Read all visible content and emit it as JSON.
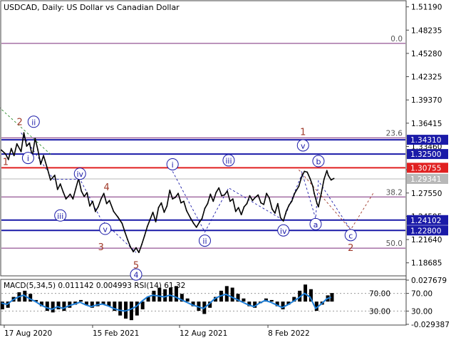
{
  "chart_data": {
    "type": "line",
    "title": "USDCAD, Daily:  US Dollar vs Canadian Dollar",
    "price_axis": {
      "ylim": [
        1.1703,
        1.5206
      ],
      "ticks": [
        "1.51190",
        "1.48235",
        "1.45280",
        "1.42325",
        "1.39370",
        "1.36415",
        "1.33460",
        "1.30505",
        "1.27550",
        "1.24595",
        "1.21640",
        "1.18685"
      ]
    },
    "x_axis": {
      "ticks": [
        {
          "label": "17 Aug 2020",
          "bar": 2
        },
        {
          "label": "15 Feb 2021",
          "bar": 65
        },
        {
          "label": "12 Aug 2021",
          "bar": 127
        },
        {
          "label": "8 Feb 2022",
          "bar": 190
        }
      ],
      "bars_total": 288
    },
    "levels": [
      {
        "price": 1.3431,
        "label": "1.34310",
        "color": "#1a1aa8",
        "kind": "support-resistance"
      },
      {
        "price": 1.325,
        "label": "1.32500",
        "color": "#1a1aa8",
        "kind": "support-resistance"
      },
      {
        "price": 1.30755,
        "label": "1.30755",
        "color": "#e02020",
        "kind": "pivot"
      },
      {
        "price": 1.2934,
        "label": "1.29341",
        "color": "#b8b8b8",
        "kind": "current-price"
      },
      {
        "price": 1.2411,
        "label": "1.24102",
        "color": "#1a1aa8",
        "kind": "support-resistance"
      },
      {
        "price": 1.228,
        "label": "1.22800",
        "color": "#1a1aa8",
        "kind": "support-resistance"
      }
    ],
    "fibonacci": [
      {
        "price": 1.4655,
        "label": "0.0"
      },
      {
        "price": 1.3455,
        "label": "23.6"
      },
      {
        "price": 1.2705,
        "label": "38.2"
      },
      {
        "price": 1.2055,
        "label": "50.0"
      }
    ],
    "price_series": [
      [
        0,
        1.33
      ],
      [
        3,
        1.325
      ],
      [
        5,
        1.318
      ],
      [
        7,
        1.332
      ],
      [
        9,
        1.323
      ],
      [
        11,
        1.338
      ],
      [
        14,
        1.328
      ],
      [
        16,
        1.352
      ],
      [
        18,
        1.335
      ],
      [
        20,
        1.339
      ],
      [
        22,
        1.322
      ],
      [
        24,
        1.345
      ],
      [
        26,
        1.33
      ],
      [
        28,
        1.312
      ],
      [
        30,
        1.323
      ],
      [
        33,
        1.305
      ],
      [
        35,
        1.292
      ],
      [
        38,
        1.298
      ],
      [
        40,
        1.28
      ],
      [
        42,
        1.287
      ],
      [
        44,
        1.277
      ],
      [
        46,
        1.268
      ],
      [
        49,
        1.274
      ],
      [
        51,
        1.268
      ],
      [
        53,
        1.281
      ],
      [
        55,
        1.294
      ],
      [
        57,
        1.278
      ],
      [
        59,
        1.271
      ],
      [
        61,
        1.276
      ],
      [
        63,
        1.259
      ],
      [
        65,
        1.265
      ],
      [
        67,
        1.252
      ],
      [
        69,
        1.258
      ],
      [
        71,
        1.268
      ],
      [
        73,
        1.275
      ],
      [
        75,
        1.262
      ],
      [
        77,
        1.266
      ],
      [
        80,
        1.252
      ],
      [
        83,
        1.245
      ],
      [
        86,
        1.237
      ],
      [
        88,
        1.226
      ],
      [
        90,
        1.216
      ],
      [
        92,
        1.207
      ],
      [
        94,
        1.201
      ],
      [
        96,
        1.206
      ],
      [
        98,
        1.2
      ],
      [
        100,
        1.21
      ],
      [
        102,
        1.221
      ],
      [
        104,
        1.233
      ],
      [
        106,
        1.242
      ],
      [
        108,
        1.251
      ],
      [
        110,
        1.239
      ],
      [
        112,
        1.257
      ],
      [
        114,
        1.263
      ],
      [
        116,
        1.251
      ],
      [
        118,
        1.259
      ],
      [
        120,
        1.279
      ],
      [
        122,
        1.268
      ],
      [
        124,
        1.27
      ],
      [
        126,
        1.275
      ],
      [
        128,
        1.263
      ],
      [
        130,
        1.265
      ],
      [
        132,
        1.253
      ],
      [
        135,
        1.243
      ],
      [
        137,
        1.237
      ],
      [
        139,
        1.232
      ],
      [
        141,
        1.238
      ],
      [
        143,
        1.243
      ],
      [
        145,
        1.256
      ],
      [
        147,
        1.262
      ],
      [
        149,
        1.274
      ],
      [
        151,
        1.265
      ],
      [
        153,
        1.276
      ],
      [
        155,
        1.282
      ],
      [
        157,
        1.272
      ],
      [
        159,
        1.273
      ],
      [
        161,
        1.278
      ],
      [
        163,
        1.265
      ],
      [
        165,
        1.268
      ],
      [
        167,
        1.252
      ],
      [
        169,
        1.257
      ],
      [
        171,
        1.248
      ],
      [
        173,
        1.258
      ],
      [
        175,
        1.262
      ],
      [
        177,
        1.272
      ],
      [
        179,
        1.266
      ],
      [
        181,
        1.27
      ],
      [
        183,
        1.273
      ],
      [
        185,
        1.263
      ],
      [
        187,
        1.261
      ],
      [
        189,
        1.275
      ],
      [
        191,
        1.269
      ],
      [
        193,
        1.255
      ],
      [
        195,
        1.25
      ],
      [
        197,
        1.262
      ],
      [
        199,
        1.244
      ],
      [
        201,
        1.24
      ],
      [
        203,
        1.252
      ],
      [
        205,
        1.26
      ],
      [
        207,
        1.265
      ],
      [
        209,
        1.275
      ],
      [
        212,
        1.284
      ],
      [
        214,
        1.296
      ],
      [
        216,
        1.303
      ],
      [
        218,
        1.302
      ],
      [
        220,
        1.294
      ],
      [
        222,
        1.284
      ],
      [
        223,
        1.275
      ],
      [
        225,
        1.262
      ],
      [
        226,
        1.258
      ],
      [
        228,
        1.275
      ],
      [
        230,
        1.293
      ],
      [
        232,
        1.304
      ],
      [
        233,
        1.298
      ],
      [
        235,
        1.292
      ],
      [
        237,
        1.294
      ]
    ],
    "wave_labels": [
      {
        "text": "1",
        "bar": 3,
        "price": 1.315,
        "color": "#a03a2a",
        "circle": false
      },
      {
        "text": "2",
        "bar": 13,
        "price": 1.366,
        "color": "#a03a2a",
        "circle": false
      },
      {
        "text": "ii",
        "bar": 23,
        "price": 1.366,
        "color": "#1a1aa8",
        "circle": true
      },
      {
        "text": "i",
        "bar": 19,
        "price": 1.32,
        "color": "#1a1aa8",
        "circle": true
      },
      {
        "text": "iv",
        "bar": 56,
        "price": 1.3,
        "color": "#1a1aa8",
        "circle": true
      },
      {
        "text": "4",
        "bar": 75,
        "price": 1.283,
        "color": "#a03a2a",
        "circle": false
      },
      {
        "text": "iii",
        "bar": 42,
        "price": 1.247,
        "color": "#1a1aa8",
        "circle": true
      },
      {
        "text": "v",
        "bar": 74,
        "price": 1.23,
        "color": "#1a1aa8",
        "circle": true
      },
      {
        "text": "3",
        "bar": 71,
        "price": 1.207,
        "color": "#a03a2a",
        "circle": false
      },
      {
        "text": "5",
        "bar": 96,
        "price": 1.184,
        "color": "#a03a2a",
        "circle": false
      },
      {
        "text": "(",
        "bar": 94,
        "price": 1.174,
        "color": "#2a8a2a",
        "circle": false
      },
      {
        "text": "(",
        "bar": 95,
        "price": 1.172,
        "color": "#2a8a2a",
        "circle": false
      },
      {
        "text": "4",
        "bar": 96,
        "price": 1.172,
        "color": "#1a1aa8",
        "circle": true
      },
      {
        "text": "i",
        "bar": 122,
        "price": 1.312,
        "color": "#1a1aa8",
        "circle": true
      },
      {
        "text": "ii",
        "bar": 145,
        "price": 1.215,
        "color": "#1a1aa8",
        "circle": true
      },
      {
        "text": "iii",
        "bar": 162,
        "price": 1.317,
        "color": "#1a1aa8",
        "circle": true
      },
      {
        "text": "iv",
        "bar": 201,
        "price": 1.228,
        "color": "#1a1aa8",
        "circle": true
      },
      {
        "text": "v",
        "bar": 215,
        "price": 1.336,
        "color": "#1a1aa8",
        "circle": true
      },
      {
        "text": "1",
        "bar": 215,
        "price": 1.353,
        "color": "#a03a2a",
        "circle": false
      },
      {
        "text": "b",
        "bar": 226,
        "price": 1.316,
        "color": "#1a1aa8",
        "circle": true
      },
      {
        "text": "a",
        "bar": 224,
        "price": 1.236,
        "color": "#1a1aa8",
        "circle": true
      },
      {
        "text": "c",
        "bar": 249,
        "price": 1.222,
        "color": "#1a1aa8",
        "circle": true
      },
      {
        "text": "2",
        "bar": 249,
        "price": 1.206,
        "color": "#a03a2a",
        "circle": false
      }
    ],
    "trend_lines": [
      {
        "color": "#2a8a2a",
        "dash": true,
        "points": [
          [
            -2,
            1.385
          ],
          [
            36,
            1.323
          ]
        ]
      },
      {
        "color": "#1a1aa8",
        "dash": true,
        "points": [
          [
            14,
            1.352
          ],
          [
            37,
            1.293
          ],
          [
            56,
            1.293
          ],
          [
            71,
            1.242
          ],
          [
            96,
            1.2
          ]
        ]
      },
      {
        "color": "#1a1aa8",
        "dash": true,
        "points": [
          [
            122,
            1.303
          ],
          [
            145,
            1.226
          ],
          [
            162,
            1.282
          ],
          [
            201,
            1.241
          ],
          [
            215,
            1.303
          ]
        ]
      },
      {
        "color": "#1a1aa8",
        "dash": true,
        "points": [
          [
            214,
            1.303
          ],
          [
            224,
            1.243
          ],
          [
            226,
            1.291
          ],
          [
            249,
            1.229
          ]
        ]
      },
      {
        "color": "#a03a2a",
        "dash": true,
        "points": [
          [
            212,
            1.305
          ],
          [
            249,
            1.229
          ],
          [
            265,
            1.275
          ]
        ]
      }
    ],
    "indicator": {
      "title": "MACD(5,34,5) 0.011142 0.004993 RSI(14) 61.32",
      "left_labels": [
        "70.00",
        "30.00"
      ],
      "right_labels": [
        "0.027679",
        "70.00",
        "30.00",
        "-0.029387"
      ],
      "macd_hist": [
        [
          0,
          -0.01
        ],
        [
          4,
          -0.008
        ],
        [
          8,
          0.006
        ],
        [
          12,
          0.012
        ],
        [
          16,
          0.014
        ],
        [
          20,
          0.01
        ],
        [
          24,
          0.002
        ],
        [
          28,
          -0.006
        ],
        [
          32,
          -0.012
        ],
        [
          36,
          -0.014
        ],
        [
          40,
          -0.01
        ],
        [
          44,
          -0.012
        ],
        [
          48,
          -0.008
        ],
        [
          52,
          -0.004
        ],
        [
          56,
          0.002
        ],
        [
          60,
          -0.004
        ],
        [
          64,
          -0.008
        ],
        [
          68,
          -0.006
        ],
        [
          72,
          -0.004
        ],
        [
          76,
          -0.006
        ],
        [
          80,
          -0.012
        ],
        [
          84,
          -0.018
        ],
        [
          88,
          -0.022
        ],
        [
          92,
          -0.024
        ],
        [
          96,
          -0.018
        ],
        [
          100,
          -0.01
        ],
        [
          104,
          0.006
        ],
        [
          108,
          0.014
        ],
        [
          112,
          0.018
        ],
        [
          116,
          0.016
        ],
        [
          120,
          0.018
        ],
        [
          124,
          0.02
        ],
        [
          128,
          0.01
        ],
        [
          132,
          0.004
        ],
        [
          136,
          -0.006
        ],
        [
          140,
          -0.012
        ],
        [
          144,
          -0.016
        ],
        [
          148,
          -0.008
        ],
        [
          152,
          0.006
        ],
        [
          156,
          0.014
        ],
        [
          160,
          0.02
        ],
        [
          164,
          0.018
        ],
        [
          168,
          0.01
        ],
        [
          172,
          0.004
        ],
        [
          176,
          -0.006
        ],
        [
          180,
          -0.008
        ],
        [
          184,
          -0.002
        ],
        [
          188,
          0.004
        ],
        [
          192,
          0.002
        ],
        [
          196,
          -0.006
        ],
        [
          200,
          -0.01
        ],
        [
          204,
          -0.004
        ],
        [
          208,
          0.006
        ],
        [
          212,
          0.014
        ],
        [
          216,
          0.022
        ],
        [
          220,
          0.016
        ],
        [
          224,
          -0.012
        ],
        [
          228,
          -0.004
        ],
        [
          232,
          0.008
        ],
        [
          235,
          0.011
        ]
      ],
      "rsi": [
        [
          0,
          48
        ],
        [
          4,
          45
        ],
        [
          8,
          55
        ],
        [
          12,
          62
        ],
        [
          16,
          66
        ],
        [
          20,
          58
        ],
        [
          24,
          52
        ],
        [
          28,
          44
        ],
        [
          32,
          38
        ],
        [
          36,
          34
        ],
        [
          40,
          40
        ],
        [
          44,
          36
        ],
        [
          48,
          42
        ],
        [
          52,
          46
        ],
        [
          56,
          50
        ],
        [
          60,
          44
        ],
        [
          64,
          40
        ],
        [
          68,
          44
        ],
        [
          72,
          46
        ],
        [
          76,
          42
        ],
        [
          80,
          36
        ],
        [
          84,
          32
        ],
        [
          88,
          30
        ],
        [
          92,
          34
        ],
        [
          96,
          40
        ],
        [
          100,
          52
        ],
        [
          104,
          62
        ],
        [
          108,
          66
        ],
        [
          112,
          64
        ],
        [
          116,
          62
        ],
        [
          120,
          66
        ],
        [
          124,
          62
        ],
        [
          128,
          56
        ],
        [
          132,
          50
        ],
        [
          136,
          44
        ],
        [
          140,
          40
        ],
        [
          144,
          36
        ],
        [
          148,
          46
        ],
        [
          152,
          58
        ],
        [
          156,
          64
        ],
        [
          160,
          68
        ],
        [
          164,
          62
        ],
        [
          168,
          56
        ],
        [
          172,
          50
        ],
        [
          176,
          44
        ],
        [
          180,
          40
        ],
        [
          184,
          48
        ],
        [
          188,
          54
        ],
        [
          192,
          50
        ],
        [
          196,
          44
        ],
        [
          200,
          38
        ],
        [
          204,
          44
        ],
        [
          208,
          52
        ],
        [
          212,
          60
        ],
        [
          216,
          70
        ],
        [
          220,
          62
        ],
        [
          224,
          36
        ],
        [
          228,
          46
        ],
        [
          232,
          58
        ],
        [
          235,
          61
        ]
      ]
    }
  }
}
